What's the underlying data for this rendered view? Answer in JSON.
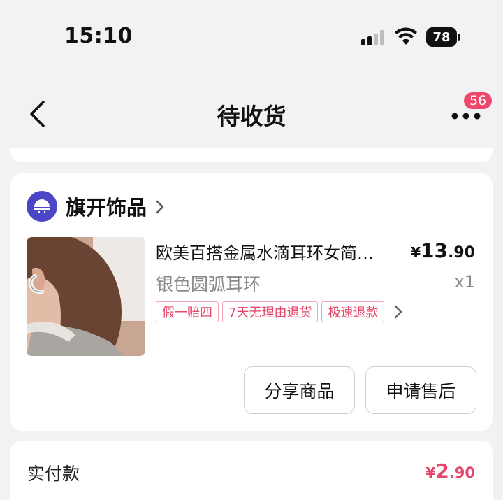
{
  "status_bar": {
    "time": "15:10",
    "battery": "78",
    "icons": [
      "signal-icon",
      "wifi-icon",
      "battery-icon"
    ]
  },
  "nav": {
    "title": "待收货",
    "badge_count": "56",
    "icons": [
      "back-chevron-icon",
      "more-dots-icon"
    ]
  },
  "shop": {
    "name": "旗开饰品",
    "icon": "shop-logo-icon"
  },
  "product": {
    "title": "欧美百搭金属水滴耳环女简…",
    "price_symbol": "¥",
    "price_int": "13",
    "price_dec": ".90",
    "spec": "银色圆弧耳环",
    "quantity": "x1",
    "tags": [
      "假一赔四",
      "7天无理由退货",
      "极速退款"
    ]
  },
  "actions": {
    "share_label": "分享商品",
    "after_sale_label": "申请售后"
  },
  "payment": {
    "label": "实付款",
    "symbol": "¥",
    "amount_int": "2",
    "amount_dec": ".90"
  },
  "colors": {
    "accent": "#e5476a",
    "badge": "#f0476a",
    "shop_logo": "#4b46c8",
    "background": "#f2f2f4"
  }
}
